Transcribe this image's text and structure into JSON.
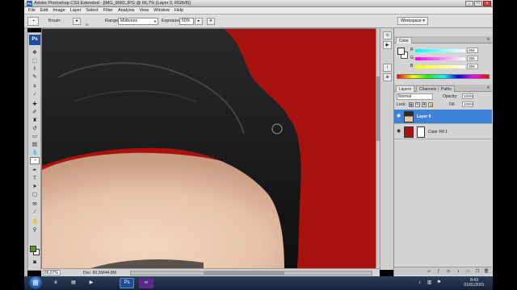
{
  "app": {
    "title": "Adobe Photoshop CS3 Extended - [IMG_9082.JPG @ 66,7% (Layer 0, RGB/8)]",
    "logo": "Ps"
  },
  "window_buttons": [
    "_",
    "□",
    "x"
  ],
  "menu": [
    "File",
    "Edit",
    "Image",
    "Layer",
    "Select",
    "Filter",
    "Analysis",
    "View",
    "Window",
    "Help"
  ],
  "options": {
    "brush_label": "Brush:",
    "brush_size": "75",
    "range_label": "Range:",
    "range_value": "Midtones",
    "exposure_label": "Exposure:",
    "exposure_value": "50%",
    "workspace_label": "Workspace ▾"
  },
  "toolbox": {
    "icons": [
      "move-icon",
      "marquee-icon",
      "lasso-icon",
      "quick-select-icon",
      "crop-icon",
      "slice-icon",
      "healing-icon",
      "brush-icon",
      "clone-stamp-icon",
      "history-brush-icon",
      "eraser-icon",
      "gradient-icon",
      "blur-icon",
      "burn-icon",
      "pen-icon",
      "type-icon",
      "path-select-icon",
      "shape-icon",
      "notes-icon",
      "eyedropper-icon",
      "hand-icon",
      "zoom-icon"
    ],
    "foreground_color": "#5a9a2c",
    "background_color": "#ffffff"
  },
  "canvas": {
    "background_color": "#a8130f"
  },
  "status": {
    "zoom": "66,67%",
    "doc": "Doc: 60,2M/44,8M"
  },
  "color_panel": {
    "tab": "Color",
    "channels": [
      {
        "name": "R",
        "value": "255",
        "gradient": "linear-gradient(90deg,#00ffff,#ffffff)"
      },
      {
        "name": "G",
        "value": "255",
        "gradient": "linear-gradient(90deg,#ff00ff,#ffffff)"
      },
      {
        "name": "B",
        "value": "255",
        "gradient": "linear-gradient(90deg,#ffff00,#ffffff)"
      }
    ]
  },
  "layers_panel": {
    "tabs": [
      "Layers",
      "Channels",
      "Paths"
    ],
    "blend_mode": "Normal",
    "opacity_label": "Opacity:",
    "opacity_value": "100%",
    "lock_label": "Lock:",
    "fill_label": "Fill:",
    "fill_value": "100%",
    "layers": [
      {
        "name": "Layer 0",
        "selected": true
      },
      {
        "name": "Color Fill 1",
        "selected": false,
        "fill_color": "#a8130f"
      }
    ]
  },
  "taskbar": {
    "items": [
      "ie-icon",
      "explorer-icon",
      "media-icon",
      "photoshop-icon",
      "vs-icon"
    ],
    "time": "8:43",
    "date": "01/01/2001"
  },
  "accent_color": "#3e82d8"
}
